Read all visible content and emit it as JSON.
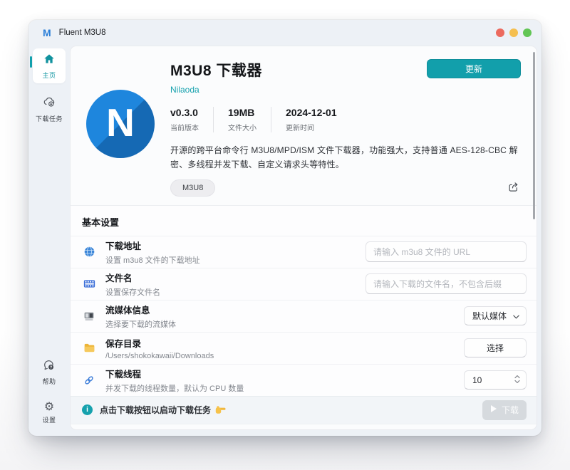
{
  "window": {
    "title": "Fluent M3U8",
    "traffic_lights": {
      "close": "#ec6a5e",
      "minimize": "#f5bf4f",
      "zoom": "#61c554"
    }
  },
  "sidebar": {
    "home": {
      "label": "主页",
      "icon": "home-icon",
      "active": true
    },
    "tasks": {
      "label": "下载任务",
      "icon": "cloud-download-icon"
    },
    "help": {
      "label": "帮助",
      "icon": "help-bubble-icon"
    },
    "settings": {
      "label": "设置",
      "icon": "gear-icon",
      "gear_glyph": "⚙"
    }
  },
  "hero": {
    "title": "M3U8 下载器",
    "author": "Nilaoda",
    "logo_letter": "N",
    "update_button": "更新",
    "stats": [
      {
        "value": "v0.3.0",
        "label": "当前版本"
      },
      {
        "value": "19MB",
        "label": "文件大小"
      },
      {
        "value": "2024-12-01",
        "label": "更新时间"
      }
    ],
    "description": "开源的跨平台命令行 M3U8/MPD/ISM 文件下载器，功能强大，支持普通 AES-128-CBC 解密、多线程并发下载、自定义请求头等特性。",
    "tag": "M3U8",
    "share_icon": "share-icon"
  },
  "settings": {
    "section_title": "基本设置",
    "rows": [
      {
        "icon": "globe-icon",
        "title": "下载地址",
        "subtitle": "设置 m3u8 文件的下载地址",
        "control": "input",
        "placeholder": "请输入 m3u8 文件的 URL"
      },
      {
        "icon": "film-icon",
        "title": "文件名",
        "subtitle": "设置保存文件名",
        "control": "input",
        "placeholder": "请输入下载的文件名，不包含后缀"
      },
      {
        "icon": "media-stream-icon",
        "title": "流媒体信息",
        "subtitle": "选择要下载的流媒体",
        "control": "select",
        "value": "默认媒体"
      },
      {
        "icon": "folder-icon",
        "title": "保存目录",
        "subtitle": "/Users/shokokawaii/Downloads",
        "control": "button",
        "button_label": "选择"
      },
      {
        "icon": "thread-icon",
        "title": "下载线程",
        "subtitle": "并发下载的线程数量，默认为 CPU 数量",
        "control": "number",
        "value": "10"
      }
    ]
  },
  "footer": {
    "hint": "点击下载按钮以启动下载任务",
    "hint_emoji": "👉",
    "download_button": "下载",
    "download_enabled": false
  },
  "colors": {
    "accent_teal": "#12a0ac",
    "logo_blue": "#1e86dd",
    "logo_blue_dark": "#1569b4",
    "folder_yellow": "#f5c24a",
    "window_bg": "#edf1f6",
    "card_bg": "#fbfcfd"
  }
}
